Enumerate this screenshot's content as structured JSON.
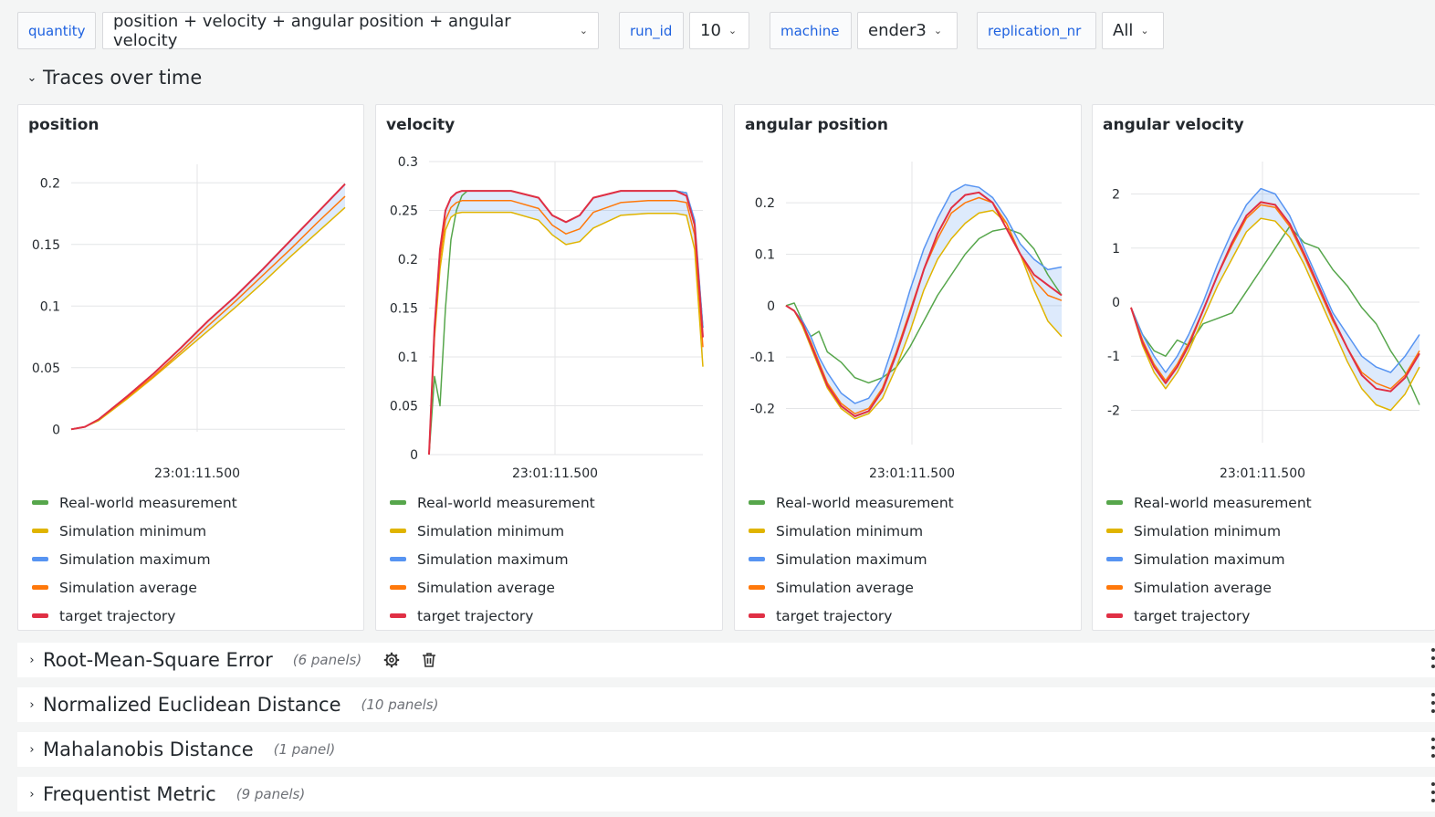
{
  "variables": [
    {
      "label": "quantity",
      "value": "position + velocity + angular position + angular velocity"
    },
    {
      "label": "run_id",
      "value": "10"
    },
    {
      "label": "machine",
      "value": "ender3"
    },
    {
      "label": "replication_nr",
      "value": "All"
    }
  ],
  "rows": {
    "traces": {
      "title": "Traces over time"
    },
    "rmse": {
      "title": "Root-Mean-Square Error",
      "count": "(6 panels)"
    },
    "ned": {
      "title": "Normalized Euclidean Distance",
      "count": "(10 panels)"
    },
    "mahal": {
      "title": "Mahalanobis Distance",
      "count": "(1 panel)"
    },
    "freq": {
      "title": "Frequentist Metric",
      "count": "(9 panels)"
    }
  },
  "legend": [
    {
      "name": "Real-world measurement",
      "color": "#56a64b"
    },
    {
      "name": "Simulation minimum",
      "color": "#e0b400"
    },
    {
      "name": "Simulation maximum",
      "color": "#5794f2"
    },
    {
      "name": "Simulation average",
      "color": "#ff780a"
    },
    {
      "name": "target trajectory",
      "color": "#e02f44"
    }
  ],
  "chart_data": [
    {
      "type": "line",
      "title": "position",
      "x_tick": "23:01:11.500",
      "yticks": [
        "0.2",
        "0.15",
        "0.1",
        "0.05",
        "0"
      ],
      "ytick_values": [
        0.2,
        0.15,
        0.1,
        0.05,
        0
      ],
      "ylim": [
        -0.002,
        0.215
      ],
      "x": [
        0,
        0.05,
        0.1,
        0.2,
        0.3,
        0.4,
        0.5,
        0.6,
        0.7,
        0.8,
        0.9,
        1.0
      ],
      "series": [
        {
          "name": "Real-world measurement",
          "values": [
            0,
            0.002,
            0.008,
            0.026,
            0.045,
            0.066,
            0.088,
            0.108,
            0.13,
            0.153,
            0.176,
            0.199
          ]
        },
        {
          "name": "Simulation minimum",
          "values": [
            0,
            0.002,
            0.007,
            0.024,
            0.042,
            0.061,
            0.08,
            0.099,
            0.119,
            0.14,
            0.16,
            0.18
          ]
        },
        {
          "name": "Simulation maximum",
          "values": [
            0,
            0.002,
            0.008,
            0.026,
            0.045,
            0.066,
            0.088,
            0.108,
            0.13,
            0.153,
            0.176,
            0.199
          ]
        },
        {
          "name": "Simulation average",
          "values": [
            0,
            0.002,
            0.008,
            0.025,
            0.043,
            0.063,
            0.084,
            0.104,
            0.125,
            0.146,
            0.168,
            0.189
          ]
        },
        {
          "name": "target trajectory",
          "values": [
            0,
            0.002,
            0.008,
            0.026,
            0.045,
            0.066,
            0.088,
            0.108,
            0.13,
            0.153,
            0.176,
            0.199
          ]
        }
      ]
    },
    {
      "type": "line",
      "title": "velocity",
      "x_tick": "23:01:11.500",
      "yticks": [
        "0.3",
        "0.25",
        "0.2",
        "0.15",
        "0.1",
        "0.05",
        "0"
      ],
      "ytick_values": [
        0.3,
        0.25,
        0.2,
        0.15,
        0.1,
        0.05,
        0
      ],
      "ylim": [
        0,
        0.3
      ],
      "x": [
        0,
        0.02,
        0.04,
        0.06,
        0.08,
        0.1,
        0.12,
        0.14,
        0.2,
        0.3,
        0.4,
        0.45,
        0.5,
        0.55,
        0.6,
        0.7,
        0.8,
        0.9,
        0.94,
        0.97,
        1.0
      ],
      "series": [
        {
          "name": "Real-world measurement",
          "values": [
            0,
            0.08,
            0.05,
            0.15,
            0.22,
            0.25,
            0.265,
            0.27,
            0.27,
            0.27,
            0.263,
            0.245,
            0.238,
            0.245,
            0.263,
            0.27,
            0.27,
            0.27,
            0.268,
            0.235,
            0.13
          ]
        },
        {
          "name": "Simulation minimum",
          "values": [
            0,
            0.12,
            0.19,
            0.23,
            0.243,
            0.247,
            0.248,
            0.248,
            0.248,
            0.248,
            0.24,
            0.225,
            0.215,
            0.218,
            0.232,
            0.245,
            0.247,
            0.247,
            0.245,
            0.21,
            0.09
          ]
        },
        {
          "name": "Simulation maximum",
          "values": [
            0,
            0.13,
            0.21,
            0.25,
            0.263,
            0.268,
            0.27,
            0.27,
            0.27,
            0.27,
            0.263,
            0.245,
            0.238,
            0.245,
            0.263,
            0.27,
            0.27,
            0.27,
            0.268,
            0.24,
            0.13
          ]
        },
        {
          "name": "Simulation average",
          "values": [
            0,
            0.125,
            0.2,
            0.24,
            0.253,
            0.258,
            0.26,
            0.26,
            0.26,
            0.26,
            0.252,
            0.235,
            0.226,
            0.231,
            0.248,
            0.258,
            0.26,
            0.26,
            0.258,
            0.225,
            0.11
          ]
        },
        {
          "name": "target trajectory",
          "values": [
            0,
            0.13,
            0.21,
            0.25,
            0.263,
            0.268,
            0.27,
            0.27,
            0.27,
            0.27,
            0.263,
            0.245,
            0.238,
            0.245,
            0.263,
            0.27,
            0.27,
            0.27,
            0.265,
            0.235,
            0.12
          ]
        }
      ]
    },
    {
      "type": "line",
      "title": "angular position",
      "x_tick": "23:01:11.500",
      "yticks": [
        "0.2",
        "0.1",
        "0",
        "-0.1",
        "-0.2"
      ],
      "ytick_values": [
        0.2,
        0.1,
        0,
        -0.1,
        -0.2
      ],
      "ylim": [
        -0.27,
        0.28
      ],
      "x": [
        0,
        0.03,
        0.06,
        0.09,
        0.12,
        0.15,
        0.2,
        0.25,
        0.3,
        0.35,
        0.4,
        0.45,
        0.5,
        0.55,
        0.6,
        0.65,
        0.7,
        0.75,
        0.8,
        0.85,
        0.9,
        0.95,
        1.0
      ],
      "series": [
        {
          "name": "Real-world measurement",
          "values": [
            0,
            0.005,
            -0.03,
            -0.06,
            -0.05,
            -0.09,
            -0.11,
            -0.14,
            -0.15,
            -0.14,
            -0.12,
            -0.08,
            -0.03,
            0.02,
            0.06,
            0.1,
            0.13,
            0.145,
            0.15,
            0.14,
            0.11,
            0.06,
            0.02
          ]
        },
        {
          "name": "Simulation minimum",
          "values": [
            0,
            -0.01,
            -0.04,
            -0.08,
            -0.12,
            -0.16,
            -0.2,
            -0.22,
            -0.21,
            -0.18,
            -0.12,
            -0.05,
            0.03,
            0.09,
            0.13,
            0.16,
            0.18,
            0.185,
            0.16,
            0.1,
            0.03,
            -0.03,
            -0.06
          ]
        },
        {
          "name": "Simulation maximum",
          "values": [
            0,
            -0.01,
            -0.03,
            -0.06,
            -0.1,
            -0.13,
            -0.17,
            -0.19,
            -0.18,
            -0.14,
            -0.06,
            0.03,
            0.11,
            0.17,
            0.22,
            0.235,
            0.23,
            0.21,
            0.17,
            0.12,
            0.09,
            0.07,
            0.075
          ]
        },
        {
          "name": "Simulation average",
          "values": [
            0,
            -0.01,
            -0.035,
            -0.07,
            -0.11,
            -0.15,
            -0.19,
            -0.21,
            -0.2,
            -0.16,
            -0.09,
            -0.01,
            0.07,
            0.13,
            0.18,
            0.2,
            0.21,
            0.2,
            0.16,
            0.1,
            0.05,
            0.02,
            0.01
          ]
        },
        {
          "name": "target trajectory",
          "values": [
            0,
            -0.01,
            -0.035,
            -0.075,
            -0.115,
            -0.155,
            -0.195,
            -0.215,
            -0.205,
            -0.165,
            -0.095,
            -0.015,
            0.07,
            0.14,
            0.19,
            0.215,
            0.22,
            0.2,
            0.15,
            0.1,
            0.06,
            0.04,
            0.02
          ]
        }
      ]
    },
    {
      "type": "line",
      "title": "angular velocity",
      "x_tick": "23:01:11.500",
      "yticks": [
        "2",
        "1",
        "0",
        "-1",
        "-2"
      ],
      "ytick_values": [
        2,
        1,
        0,
        -1,
        -2
      ],
      "ylim": [
        -2.6,
        2.6
      ],
      "x": [
        0,
        0.04,
        0.08,
        0.12,
        0.16,
        0.2,
        0.25,
        0.3,
        0.35,
        0.4,
        0.45,
        0.5,
        0.55,
        0.6,
        0.65,
        0.7,
        0.75,
        0.8,
        0.85,
        0.9,
        0.95,
        1.0
      ],
      "series": [
        {
          "name": "Real-world measurement",
          "values": [
            -0.1,
            -0.6,
            -0.9,
            -1.0,
            -0.7,
            -0.8,
            -0.4,
            -0.3,
            -0.2,
            0.2,
            0.6,
            1.0,
            1.4,
            1.1,
            1.0,
            0.6,
            0.3,
            -0.1,
            -0.4,
            -0.9,
            -1.3,
            -1.9
          ]
        },
        {
          "name": "Simulation minimum",
          "values": [
            -0.1,
            -0.8,
            -1.3,
            -1.6,
            -1.3,
            -0.9,
            -0.3,
            0.3,
            0.8,
            1.3,
            1.55,
            1.5,
            1.2,
            0.7,
            0.1,
            -0.5,
            -1.1,
            -1.6,
            -1.9,
            -2.0,
            -1.7,
            -1.2
          ]
        },
        {
          "name": "Simulation maximum",
          "values": [
            -0.1,
            -0.6,
            -1.0,
            -1.3,
            -1.0,
            -0.6,
            0.0,
            0.7,
            1.3,
            1.8,
            2.1,
            2.0,
            1.6,
            1.0,
            0.4,
            -0.2,
            -0.6,
            -1.0,
            -1.2,
            -1.3,
            -1.0,
            -0.6
          ]
        },
        {
          "name": "Simulation average",
          "values": [
            -0.1,
            -0.7,
            -1.15,
            -1.45,
            -1.15,
            -0.75,
            -0.15,
            0.5,
            1.05,
            1.55,
            1.8,
            1.75,
            1.4,
            0.85,
            0.25,
            -0.35,
            -0.85,
            -1.3,
            -1.5,
            -1.6,
            -1.35,
            -0.9
          ]
        },
        {
          "name": "target trajectory",
          "values": [
            -0.1,
            -0.75,
            -1.2,
            -1.5,
            -1.2,
            -0.8,
            -0.15,
            0.5,
            1.1,
            1.6,
            1.85,
            1.8,
            1.45,
            0.9,
            0.3,
            -0.3,
            -0.85,
            -1.35,
            -1.6,
            -1.65,
            -1.4,
            -0.95
          ]
        }
      ]
    }
  ]
}
